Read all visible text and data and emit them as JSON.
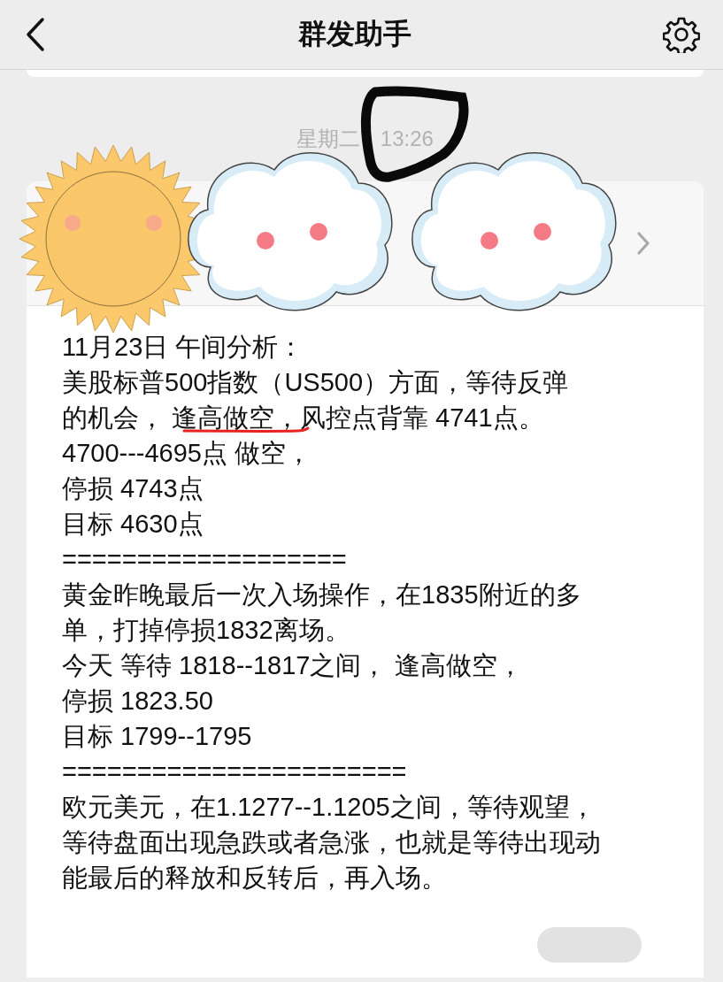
{
  "nav": {
    "title": "群发助手"
  },
  "timestamp": "星期二 13:26",
  "message": {
    "lines": [
      "11月23日  午间分析：",
      "美股标普500指数（US500）方面，等待反弹",
      "的机会， 逢高做空，风控点背靠 4741点。",
      "4700---4695点 做空，",
      "停损  4743点",
      "目标  4630点",
      "===================",
      "黄金昨晚最后一次入场操作，在1835附近的多",
      "单，打掉停损1832离场。",
      "今天 等待 1818--1817之间， 逢高做空，",
      "停损 1823.50",
      "目标  1799--1795",
      "=======================",
      "欧元美元，在1.1277--1.1205之间，等待观望，",
      "等待盘面出现急跌或者急涨，也就是等待出现动",
      "能最后的释放和反转后，再入场。"
    ],
    "footer_button": {
      "kind": "pill"
    }
  },
  "stickers": [
    {
      "kind": "sun"
    },
    {
      "kind": "cloud"
    },
    {
      "kind": "cloud"
    }
  ],
  "annotations": {
    "time_circle": true,
    "phrase_underline": true
  }
}
